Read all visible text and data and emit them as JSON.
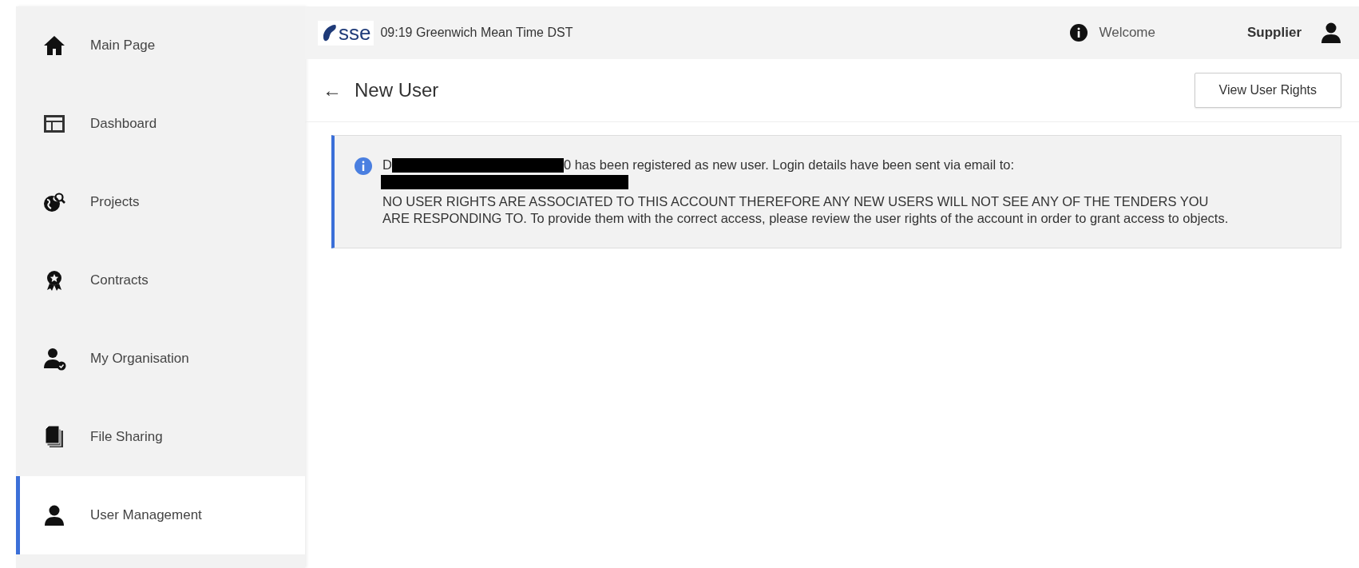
{
  "sidebar": {
    "items": [
      {
        "label": "Main Page",
        "selected": false
      },
      {
        "label": "Dashboard",
        "selected": false
      },
      {
        "label": "Projects",
        "selected": false
      },
      {
        "label": "Contracts",
        "selected": false
      },
      {
        "label": "My Organisation",
        "selected": false
      },
      {
        "label": "File Sharing",
        "selected": false
      },
      {
        "label": "User Management",
        "selected": true
      }
    ]
  },
  "header": {
    "logo": "sse",
    "time": "09:19 Greenwich Mean Time DST",
    "welcome": "Welcome",
    "role": "Supplier"
  },
  "page": {
    "back": "←",
    "title": "New User",
    "button": "View User Rights"
  },
  "alert": {
    "lead": "D",
    "line_1": "0 has been registered as new user. Login details have been sent via email to:",
    "body": "NO USER RIGHTS ARE ASSOCIATED TO THIS ACCOUNT THEREFORE ANY NEW USERS WILL NOT SEE ANY OF THE TENDERS YOU ARE RESPONDING TO. To provide them with the correct access, please review the user rights of the account in order to grant access to objects."
  }
}
